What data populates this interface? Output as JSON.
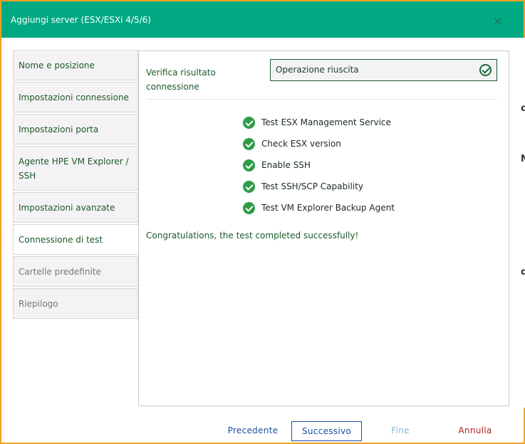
{
  "dialog": {
    "title": "Aggiungi server (ESX/ESXi 4/5/6)",
    "close_symbol": "×"
  },
  "right_edge_chars": [
    "c",
    "N",
    "d"
  ],
  "sidebar": {
    "items": [
      {
        "label": "Nome e posizione",
        "state": "normal"
      },
      {
        "label": "Impostazioni connessione",
        "state": "normal"
      },
      {
        "label": "Impostazioni porta",
        "state": "normal"
      },
      {
        "label": "Agente HPE VM Explorer / SSH",
        "state": "normal"
      },
      {
        "label": "Impostazioni avanzate",
        "state": "normal"
      },
      {
        "label": "Connessione di test",
        "state": "active"
      },
      {
        "label": "Cartelle predefinite",
        "state": "disabled"
      },
      {
        "label": "Riepilogo",
        "state": "disabled"
      }
    ]
  },
  "content": {
    "verify_label": "Verifica risultato connessione",
    "result_value": "Operazione riuscita",
    "checks": [
      "Test ESX Management Service",
      "Check ESX version",
      "Enable SSH",
      "Test SSH/SCP Capability",
      "Test VM Explorer Backup Agent"
    ],
    "congrats": "Congratulations, the test completed successfully!"
  },
  "footer": {
    "previous": "Precedente",
    "next": "Successivo",
    "finish": "Fine",
    "cancel": "Annulla"
  },
  "colors": {
    "titlebar": "#01a982",
    "frame_border": "#f0a020",
    "success_green": "#2e9c48",
    "link_blue": "#1a4fa0",
    "cancel_red": "#b02020"
  }
}
